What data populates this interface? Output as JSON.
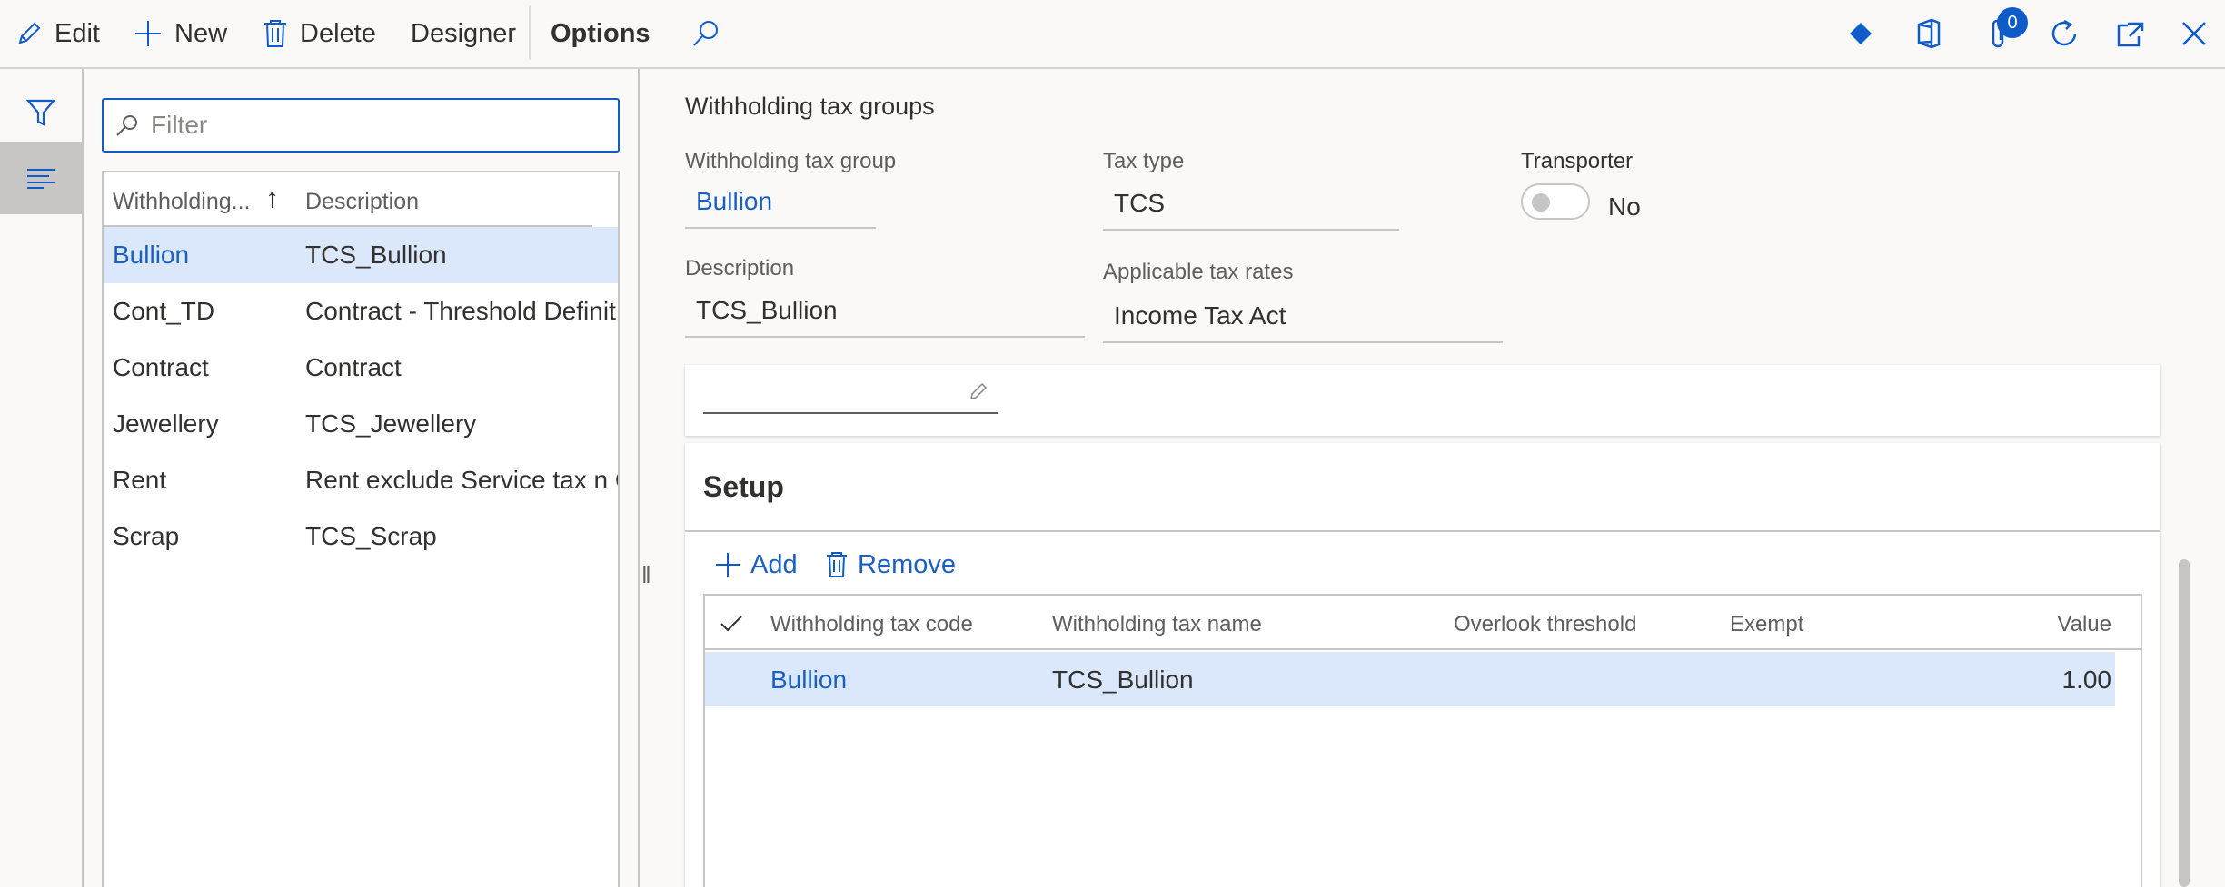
{
  "actionpane": {
    "edit_label": "Edit",
    "new_label": "New",
    "delete_label": "Delete",
    "designer_label": "Designer",
    "options_label": "Options",
    "attachments_count": "0"
  },
  "list": {
    "filter_placeholder": "Filter",
    "columns": {
      "group": "Withholding...",
      "description": "Description",
      "sort_indicator": "↑"
    },
    "rows": [
      {
        "group": "Bullion",
        "description": "TCS_Bullion",
        "selected": true
      },
      {
        "group": "Cont_TD",
        "description": "Contract - Threshold Definit"
      },
      {
        "group": "Contract",
        "description": "Contract"
      },
      {
        "group": "Jewellery",
        "description": "TCS_Jewellery"
      },
      {
        "group": "Rent",
        "description": "Rent exclude Service tax n C"
      },
      {
        "group": "Scrap",
        "description": "TCS_Scrap"
      }
    ]
  },
  "details": {
    "caption": "Withholding tax groups",
    "group_label": "Withholding tax group",
    "group_value": "Bullion",
    "tax_type_label": "Tax type",
    "tax_type_value": "TCS",
    "transporter_label": "Transporter",
    "transporter_value": "No",
    "description_label": "Description",
    "description_value": "TCS_Bullion",
    "applicable_rates_label": "Applicable tax rates",
    "applicable_rates_value": "Income Tax Act"
  },
  "setup": {
    "title": "Setup",
    "add_label": "Add",
    "remove_label": "Remove",
    "columns": {
      "code": "Withholding tax code",
      "name": "Withholding tax name",
      "overlook": "Overlook threshold",
      "exempt": "Exempt",
      "value": "Value"
    },
    "rows": [
      {
        "code": "Bullion",
        "name": "TCS_Bullion",
        "overlook": "",
        "exempt": "",
        "value": "1.00"
      }
    ]
  },
  "colors": {
    "accent": "#0f5cc9",
    "link": "#1b5fbf",
    "selection": "#dbe8fb"
  }
}
